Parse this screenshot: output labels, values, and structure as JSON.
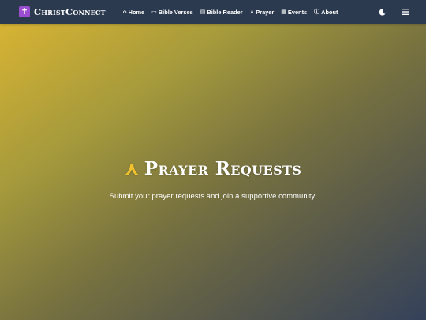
{
  "navbar": {
    "brand": {
      "icon": "cross-icon",
      "icon_glyph": "✝",
      "name": "ChristConnect"
    },
    "links": [
      {
        "icon": "house-icon",
        "glyph": "⌂",
        "label": "Home"
      },
      {
        "icon": "open-book-icon",
        "glyph": "▭",
        "label": "Bible Verses"
      },
      {
        "icon": "books-icon",
        "glyph": "▤",
        "label": "Bible Reader"
      },
      {
        "icon": "praying-hands-icon",
        "glyph": "⋏",
        "label": "Prayer"
      },
      {
        "icon": "calendar-icon",
        "glyph": "▦",
        "label": "Events"
      },
      {
        "icon": "info-icon",
        "glyph": "ⓘ",
        "label": "About"
      }
    ],
    "actions": {
      "theme_toggle": "moon-icon",
      "menu": "hamburger-menu-icon"
    }
  },
  "hero": {
    "title_icon": "praying-hands-icon",
    "title_icon_glyph": "⋏",
    "title": "Prayer Requests",
    "subtitle": "Submit your prayer requests and join a supportive community.",
    "gradient_colors": [
      "#d7b333",
      "#79733f",
      "#34415a"
    ]
  },
  "colors": {
    "navbar_bg": "#2c3a4f",
    "brand_icon_bg": "#9b4fd0",
    "text": "#ffffff"
  }
}
